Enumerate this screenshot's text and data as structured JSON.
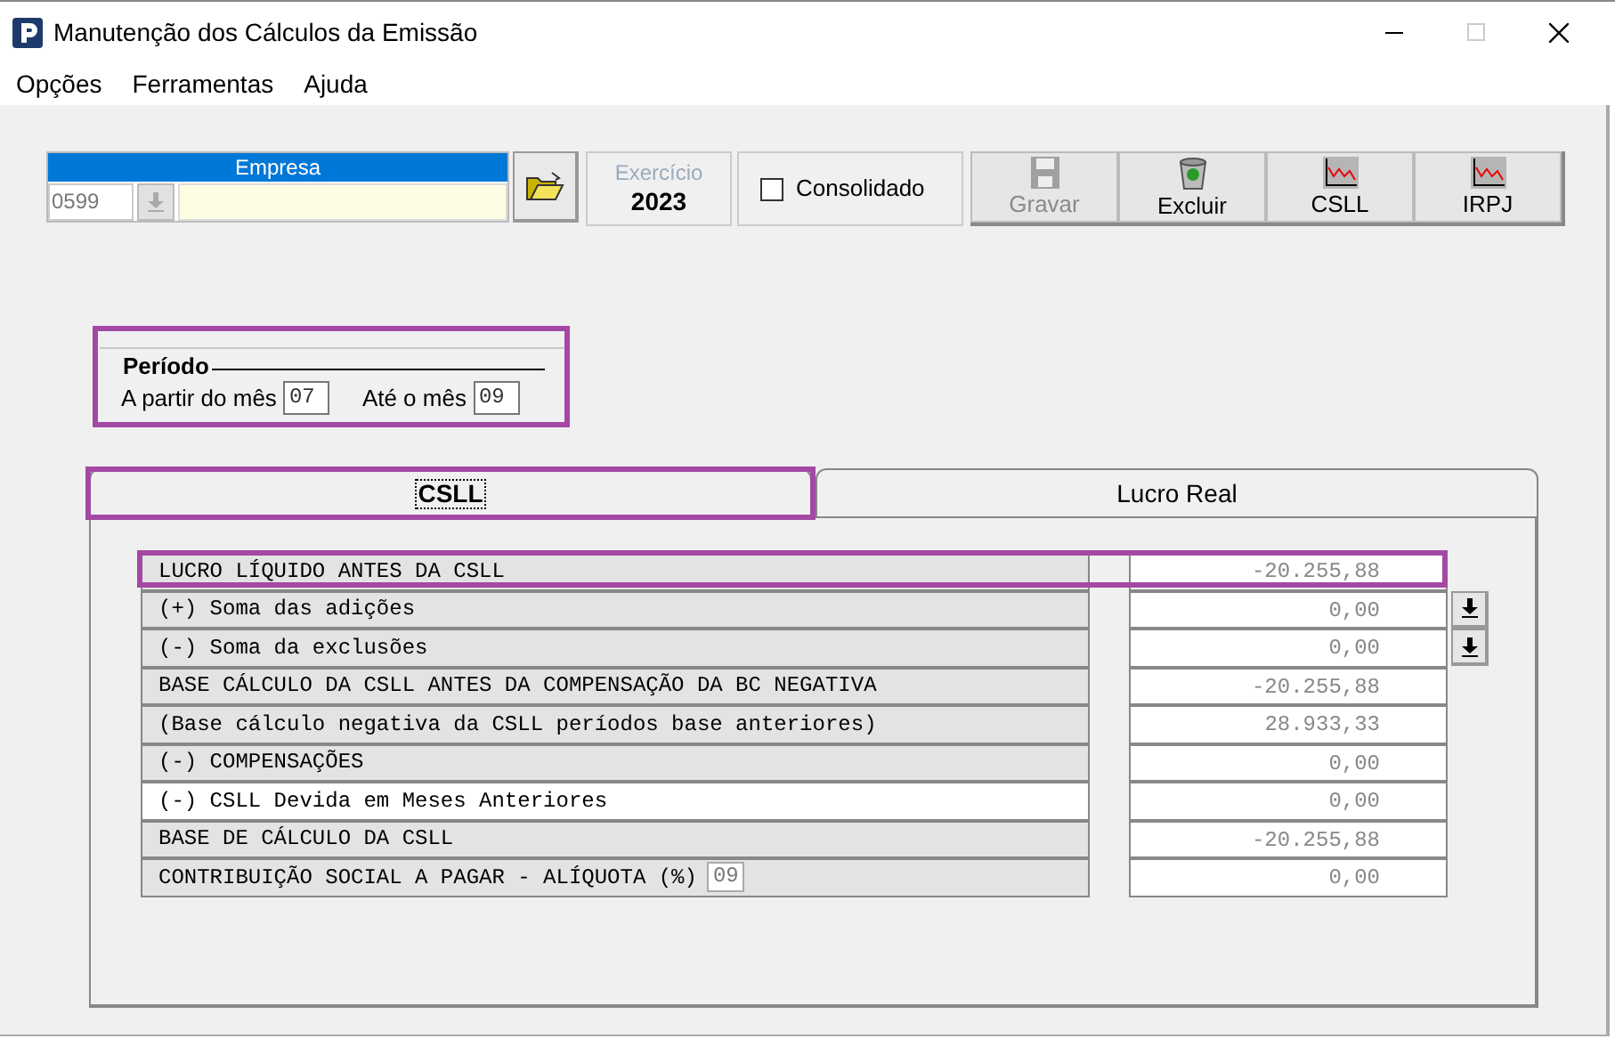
{
  "window": {
    "title": "Manutenção dos Cálculos da Emissão"
  },
  "menu": [
    "Opções",
    "Ferramentas",
    "Ajuda"
  ],
  "toolbar": {
    "empresa_label": "Empresa",
    "empresa_code": "0599",
    "exercicio_label": "Exercício",
    "exercicio_value": "2023",
    "consolidado": {
      "label": "Consolidado",
      "checked": false
    },
    "buttons": [
      {
        "label": "Gravar",
        "kind": "save",
        "disabled": true
      },
      {
        "label": "Excluir",
        "kind": "delete",
        "disabled": false
      },
      {
        "label": "CSLL",
        "kind": "chart",
        "disabled": false
      },
      {
        "label": "IRPJ",
        "kind": "chart",
        "disabled": false
      }
    ]
  },
  "periodo": {
    "title": "Período",
    "from_label": "A partir do mês",
    "from_value": "07",
    "to_label": "Até o mês",
    "to_value": "09"
  },
  "tabs": [
    {
      "label": "CSLL",
      "selected": true
    },
    {
      "label": "Lucro Real",
      "selected": false
    }
  ],
  "rows": [
    {
      "label": "LUCRO LÍQUIDO ANTES DA CSLL",
      "value": "-20.255,88",
      "has_button": false,
      "selected": false
    },
    {
      "label": "(+) Soma das adições",
      "value": "0,00",
      "has_button": true,
      "selected": false
    },
    {
      "label": "(-) Soma da exclusões",
      "value": "0,00",
      "has_button": true,
      "selected": false
    },
    {
      "label": "BASE CÁLCULO DA CSLL ANTES DA COMPENSAÇÃO DA BC NEGATIVA",
      "value": "-20.255,88",
      "has_button": false,
      "selected": false
    },
    {
      "label": "(Base cálculo negativa da CSLL períodos base anteriores)",
      "value": "28.933,33",
      "has_button": false,
      "selected": false
    },
    {
      "label": "(-) COMPENSAÇÕES",
      "value": "0,00",
      "has_button": false,
      "selected": false
    },
    {
      "label": "(-) CSLL Devida em Meses Anteriores",
      "value": "0,00",
      "has_button": false,
      "selected": true
    },
    {
      "label": "BASE DE CÁLCULO DA CSLL",
      "value": "-20.255,88",
      "has_button": false,
      "selected": false
    },
    {
      "label": "CONTRIBUIÇÃO SOCIAL A PAGAR - ALÍQUOTA (%)",
      "rate": "09",
      "value": "0,00",
      "has_button": false,
      "selected": false
    }
  ]
}
